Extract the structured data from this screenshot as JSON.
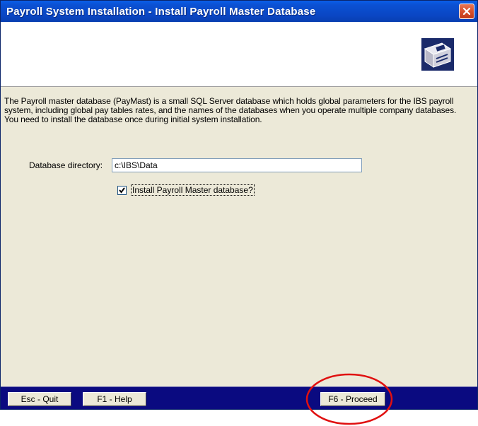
{
  "window": {
    "title": "Payroll System Installation - Install Payroll Master Database"
  },
  "header": {
    "icon": "install-disk-icon"
  },
  "content": {
    "description": "The Payroll master database (PayMast) is a small SQL Server database which holds global parameters for the IBS payroll system, including global pay tables rates, and the names of the databases when you operate multiple company databases. You need to install the database once during initial system installation.",
    "database_directory": {
      "label": "Database directory:",
      "value": "c:\\IBS\\Data"
    },
    "install_checkbox": {
      "label": "Install Payroll Master database?",
      "checked": true
    }
  },
  "footer": {
    "quit_label": "Esc - Quit",
    "help_label": "F1 - Help",
    "proceed_label": "F6 - Proceed"
  },
  "colors": {
    "titlebar": "#0b51d3",
    "footer": "#0a0a80",
    "panel": "#ece9d8",
    "annotation": "#e01010"
  }
}
